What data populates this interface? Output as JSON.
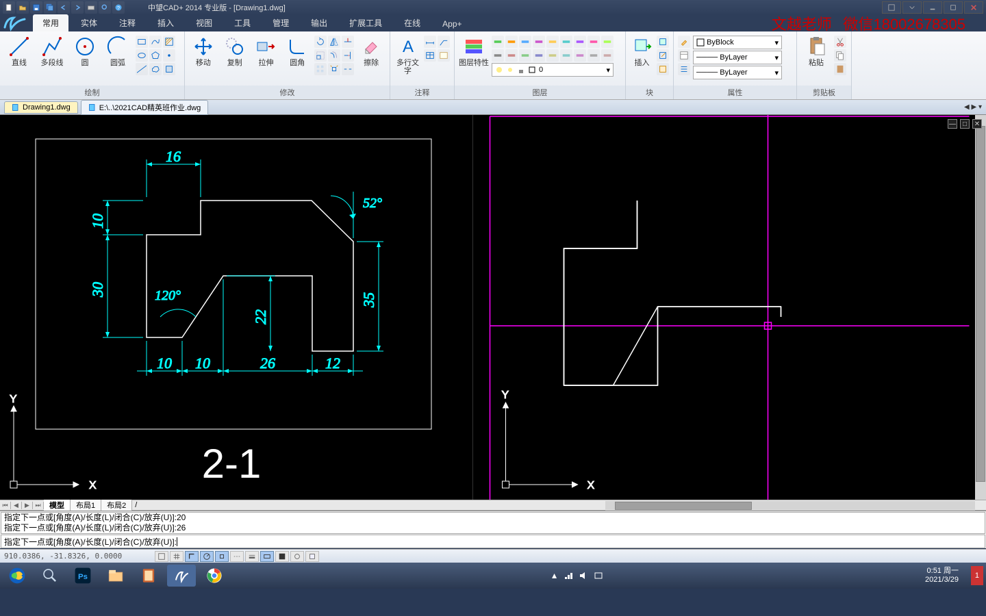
{
  "app": {
    "title": "中望CAD+ 2014 专业版 - [Drawing1.dwg]"
  },
  "watermark": {
    "text1": "文越老师",
    "text2": "微信18002678305"
  },
  "ribbon": {
    "tabs": [
      "常用",
      "实体",
      "注释",
      "插入",
      "视图",
      "工具",
      "管理",
      "输出",
      "扩展工具",
      "在线",
      "App+"
    ],
    "active_tab": 0,
    "panels": {
      "draw": {
        "title": "绘制",
        "btns": [
          "直线",
          "多段线",
          "圆",
          "圆弧"
        ]
      },
      "modify": {
        "title": "修改",
        "btns": [
          "移动",
          "复制",
          "拉伸",
          "圆角",
          "擦除"
        ]
      },
      "annot": {
        "title": "注释",
        "btns": [
          "多行文字"
        ]
      },
      "layer": {
        "title": "图层",
        "btn": "图层特性",
        "current": "0"
      },
      "block": {
        "title": "块",
        "btn": "插入"
      },
      "props": {
        "title": "属性",
        "color": "ByBlock",
        "ltype": "ByLayer",
        "lweight": "ByLayer"
      },
      "clip": {
        "title": "剪贴板",
        "btn": "粘贴"
      }
    }
  },
  "doctabs": {
    "items": [
      "Drawing1.dwg",
      "E:\\..\\2021CAD精英班作业.dwg"
    ],
    "active": 0
  },
  "drawing": {
    "dims": {
      "d16": "16",
      "d10a": "10",
      "d30": "30",
      "a120": "120°",
      "a52": "52°",
      "d35": "35",
      "d22": "22",
      "d10b": "10",
      "d10c": "10",
      "d26": "26",
      "d12": "12"
    },
    "label": "2-1",
    "ucs_x": "X",
    "ucs_y": "Y"
  },
  "layouttabs": {
    "items": [
      "模型",
      "布局1",
      "布局2"
    ],
    "active": 0
  },
  "command": {
    "hist1": "指定下一点或[角度(A)/长度(L)/闭合(C)/放弃(U)]:20",
    "hist2": "指定下一点或[角度(A)/长度(L)/闭合(C)/放弃(U)]:26",
    "prompt": "指定下一点或[角度(A)/长度(L)/闭合(C)/放弃(U)]:"
  },
  "status": {
    "coords": "910.0386, -31.8326, 0.0000"
  },
  "taskbar": {
    "time": "0:51 周一",
    "date": "2021/3/29"
  }
}
